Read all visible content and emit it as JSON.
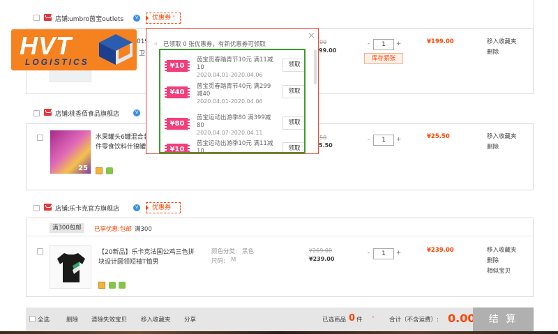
{
  "logo": {
    "main": "HVT",
    "sub": "LOGISTICS"
  },
  "shops": [
    {
      "label": "店铺:",
      "name": "umbro茵宝outlets",
      "badge": "V",
      "coupon_label": "优惠券"
    },
    {
      "label": "店铺:",
      "name": "桃香佰食品旗舰店",
      "badge": "V"
    },
    {
      "label": "店铺:",
      "name": "乐卡克官方旗舰店",
      "badge": "V",
      "coupon_label": "优惠券"
    }
  ],
  "item1": {
    "title_visible": "019",
    "title_line2": "卫",
    "old_price": "00",
    "price": "99.00",
    "qty": "1",
    "stock_warning": "库存紧张",
    "subtotal": "¥199.00",
    "op1": "移入收藏夹",
    "op2": "删除"
  },
  "item2": {
    "title_line1": "水果罐头6罐混合装",
    "title_line2": "件零食饮料什锦罐",
    "old_price": "50",
    "price": "5.50",
    "qty": "1",
    "subtotal": "¥25.50",
    "op1": "移入收藏夹",
    "op2": "删除",
    "thumb_num": "25"
  },
  "promo3": {
    "tag": "满300包邮",
    "enjoyed": "已享优惠:包邮",
    "rule": "满300"
  },
  "item3": {
    "title_line1": "【20新品】乐卡克法国公鸡三色拼",
    "title_line2": "块设计圆领短袖T恤男",
    "color_label": "颜色分类:",
    "color_value": "黑色",
    "size_label": "尺码:",
    "size_value": "M",
    "old_price": "¥269.00",
    "price": "¥239.00",
    "qty": "1",
    "subtotal": "¥239.00",
    "op1": "移入收藏夹",
    "op2": "删除",
    "op3": "相似宝贝"
  },
  "popup": {
    "header": "已领取 0 张优惠券，有新优惠券可领取",
    "close": "×",
    "coupons": [
      {
        "value": "¥10",
        "title": "茵宝觅春踏青节10元 满11减10",
        "date": "2020.04.01-2020.04.06",
        "button": "领取"
      },
      {
        "value": "¥40",
        "title": "茵宝觅春踏青节40元 满299减40",
        "date": "2020.04.01-2020.04.06",
        "button": "领取"
      },
      {
        "value": "¥80",
        "title": "茵宝运动出游季80 满399减80",
        "date": "2020.04.07-2020.04.11",
        "button": "领取"
      },
      {
        "value": "¥10",
        "title": "茵宝运动出游季10元 满11减10",
        "date": "",
        "button": "领取"
      }
    ]
  },
  "footer": {
    "select_all": "全选",
    "delete": "删除",
    "clear_invalid": "清除失效宝贝",
    "move_fav": "移入收藏夹",
    "share": "分享",
    "selected_label": "已选商品",
    "selected_count": "0",
    "selected_unit": "件",
    "total_label": "合计（不含运费）:",
    "total": "0.00",
    "settle": "结 算"
  },
  "colors": {
    "accent": "#ff4400",
    "coupon": "#f33e7a",
    "frame": "#3a9d2a",
    "brand_orange": "#f5821f",
    "brand_blue": "#1d3f8f"
  }
}
